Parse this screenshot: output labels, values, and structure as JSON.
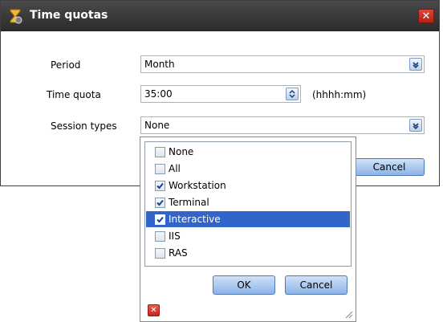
{
  "dialog": {
    "title": "Time quotas",
    "close_icon": "close-icon",
    "title_icon": "hourglass-icon",
    "cancel_label": "Cancel"
  },
  "form": {
    "period": {
      "label": "Period",
      "value": "Month"
    },
    "time_quota": {
      "label": "Time quota",
      "value": "35:00",
      "hint": "(hhhh:mm)"
    },
    "session_types": {
      "label": "Session types",
      "value": "None"
    }
  },
  "popup": {
    "items": [
      {
        "label": "None",
        "checked": false,
        "selected": false
      },
      {
        "label": "All",
        "checked": false,
        "selected": false
      },
      {
        "label": "Workstation",
        "checked": true,
        "selected": false
      },
      {
        "label": "Terminal",
        "checked": true,
        "selected": false
      },
      {
        "label": "Interactive",
        "checked": true,
        "selected": true
      },
      {
        "label": "IIS",
        "checked": false,
        "selected": false
      },
      {
        "label": "RAS",
        "checked": false,
        "selected": false
      }
    ],
    "ok_label": "OK",
    "cancel_label": "Cancel",
    "clear_icon": "clear-icon",
    "resize_icon": "resize-grip-icon"
  },
  "colors": {
    "titlebar": "#2b2b2b",
    "selection": "#3165c9",
    "button": "#8db3e6",
    "close": "#c2291c"
  }
}
